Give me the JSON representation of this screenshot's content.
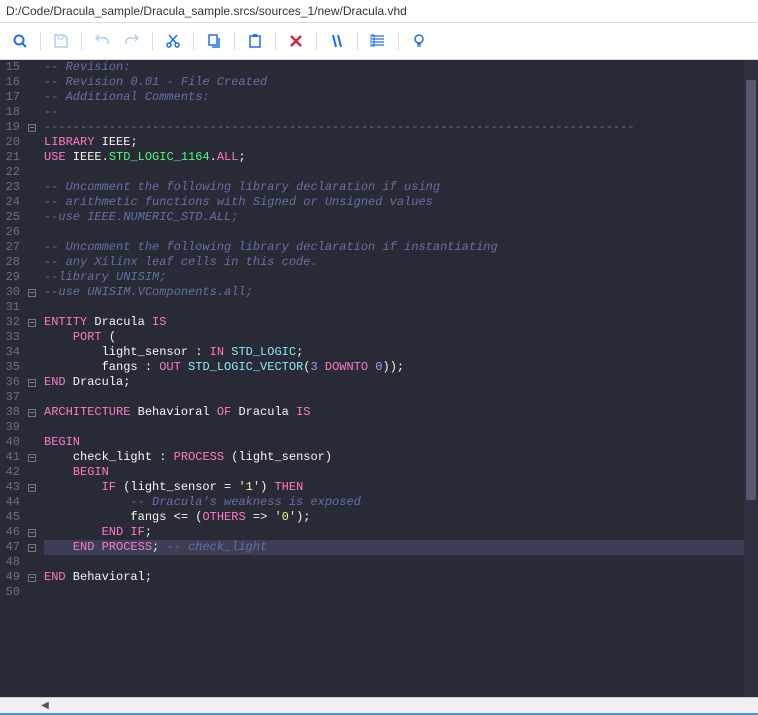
{
  "path": "D:/Code/Dracula_sample/Dracula_sample.srcs/sources_1/new/Dracula.vhd",
  "code_lines": [
    {
      "num": 15,
      "fold": "",
      "tokens": [
        {
          "c": "c-comment",
          "t": "-- Revision:"
        }
      ]
    },
    {
      "num": 16,
      "fold": "",
      "tokens": [
        {
          "c": "c-comment",
          "t": "-- Revision 0.01 - File Created"
        }
      ]
    },
    {
      "num": 17,
      "fold": "",
      "tokens": [
        {
          "c": "c-comment",
          "t": "-- Additional Comments:"
        }
      ]
    },
    {
      "num": 18,
      "fold": "",
      "tokens": [
        {
          "c": "c-comment",
          "t": "--"
        }
      ]
    },
    {
      "num": 19,
      "fold": "-",
      "tokens": [
        {
          "c": "c-comment",
          "t": "----------------------------------------------------------------------------------"
        }
      ]
    },
    {
      "num": 20,
      "fold": "",
      "tokens": [
        {
          "c": "c-key",
          "t": "LIBRARY"
        },
        {
          "c": "c-id",
          "t": " IEEE"
        },
        {
          "c": "c-punc",
          "t": ";"
        }
      ]
    },
    {
      "num": 21,
      "fold": "",
      "tokens": [
        {
          "c": "c-key",
          "t": "USE"
        },
        {
          "c": "c-id",
          "t": " IEEE"
        },
        {
          "c": "c-punc",
          "t": "."
        },
        {
          "c": "c-ent",
          "t": "STD_LOGIC_1164"
        },
        {
          "c": "c-punc",
          "t": "."
        },
        {
          "c": "c-key",
          "t": "ALL"
        },
        {
          "c": "c-punc",
          "t": ";"
        }
      ]
    },
    {
      "num": 22,
      "fold": "",
      "tokens": []
    },
    {
      "num": 23,
      "fold": "",
      "tokens": [
        {
          "c": "c-comment",
          "t": "-- Uncomment the following library declaration if using"
        }
      ]
    },
    {
      "num": 24,
      "fold": "",
      "tokens": [
        {
          "c": "c-comment",
          "t": "-- arithmetic functions with Signed or Unsigned values"
        }
      ]
    },
    {
      "num": 25,
      "fold": "",
      "tokens": [
        {
          "c": "c-comment",
          "t": "--use IEEE.NUMERIC_STD.ALL;"
        }
      ]
    },
    {
      "num": 26,
      "fold": "",
      "tokens": []
    },
    {
      "num": 27,
      "fold": "",
      "tokens": [
        {
          "c": "c-comment",
          "t": "-- Uncomment the following library declaration if instantiating"
        }
      ]
    },
    {
      "num": 28,
      "fold": "",
      "tokens": [
        {
          "c": "c-comment",
          "t": "-- any Xilinx leaf cells in this code."
        }
      ]
    },
    {
      "num": 29,
      "fold": "",
      "tokens": [
        {
          "c": "c-comment",
          "t": "--library UNISIM;"
        }
      ]
    },
    {
      "num": 30,
      "fold": "-",
      "tokens": [
        {
          "c": "c-comment",
          "t": "--use UNISIM.VComponents.all;"
        }
      ]
    },
    {
      "num": 31,
      "fold": "",
      "tokens": []
    },
    {
      "num": 32,
      "fold": "-",
      "tokens": [
        {
          "c": "c-key",
          "t": "ENTITY"
        },
        {
          "c": "c-id",
          "t": " Dracula "
        },
        {
          "c": "c-key",
          "t": "IS"
        }
      ]
    },
    {
      "num": 33,
      "fold": "",
      "tokens": [
        {
          "c": "",
          "t": "    "
        },
        {
          "c": "c-key",
          "t": "PORT"
        },
        {
          "c": "c-punc",
          "t": " ("
        }
      ]
    },
    {
      "num": 34,
      "fold": "",
      "tokens": [
        {
          "c": "",
          "t": "        "
        },
        {
          "c": "c-id",
          "t": "light_sensor "
        },
        {
          "c": "c-punc",
          "t": ": "
        },
        {
          "c": "c-key",
          "t": "IN"
        },
        {
          "c": "c-id",
          "t": " "
        },
        {
          "c": "c-type",
          "t": "STD_LOGIC"
        },
        {
          "c": "c-punc",
          "t": ";"
        }
      ]
    },
    {
      "num": 35,
      "fold": "",
      "tokens": [
        {
          "c": "",
          "t": "        "
        },
        {
          "c": "c-id",
          "t": "fangs "
        },
        {
          "c": "c-punc",
          "t": ": "
        },
        {
          "c": "c-key",
          "t": "OUT"
        },
        {
          "c": "c-id",
          "t": " "
        },
        {
          "c": "c-type",
          "t": "STD_LOGIC_VECTOR"
        },
        {
          "c": "c-punc",
          "t": "("
        },
        {
          "c": "c-num",
          "t": "3"
        },
        {
          "c": "c-id",
          "t": " "
        },
        {
          "c": "c-key",
          "t": "DOWNTO"
        },
        {
          "c": "c-id",
          "t": " "
        },
        {
          "c": "c-num",
          "t": "0"
        },
        {
          "c": "c-punc",
          "t": "));"
        }
      ]
    },
    {
      "num": 36,
      "fold": "-",
      "tokens": [
        {
          "c": "c-key",
          "t": "END"
        },
        {
          "c": "c-id",
          "t": " Dracula"
        },
        {
          "c": "c-punc",
          "t": ";"
        }
      ]
    },
    {
      "num": 37,
      "fold": "",
      "tokens": []
    },
    {
      "num": 38,
      "fold": "-",
      "tokens": [
        {
          "c": "c-key",
          "t": "ARCHITECTURE"
        },
        {
          "c": "c-id",
          "t": " Behavioral "
        },
        {
          "c": "c-key",
          "t": "OF"
        },
        {
          "c": "c-id",
          "t": " Dracula "
        },
        {
          "c": "c-key",
          "t": "IS"
        }
      ]
    },
    {
      "num": 39,
      "fold": "",
      "tokens": []
    },
    {
      "num": 40,
      "fold": "",
      "tokens": [
        {
          "c": "c-key",
          "t": "BEGIN"
        }
      ]
    },
    {
      "num": 41,
      "fold": "-",
      "tokens": [
        {
          "c": "",
          "t": "    "
        },
        {
          "c": "c-id",
          "t": "check_light "
        },
        {
          "c": "c-punc",
          "t": ": "
        },
        {
          "c": "c-key",
          "t": "PROCESS"
        },
        {
          "c": "c-punc",
          "t": " ("
        },
        {
          "c": "c-id",
          "t": "light_sensor"
        },
        {
          "c": "c-punc",
          "t": ")"
        }
      ]
    },
    {
      "num": 42,
      "fold": "",
      "tokens": [
        {
          "c": "",
          "t": "    "
        },
        {
          "c": "c-key",
          "t": "BEGIN"
        }
      ]
    },
    {
      "num": 43,
      "fold": "-",
      "tokens": [
        {
          "c": "",
          "t": "        "
        },
        {
          "c": "c-key",
          "t": "IF"
        },
        {
          "c": "c-punc",
          "t": " ("
        },
        {
          "c": "c-id",
          "t": "light_sensor "
        },
        {
          "c": "c-punc",
          "t": "= "
        },
        {
          "c": "c-str",
          "t": "'1'"
        },
        {
          "c": "c-punc",
          "t": ") "
        },
        {
          "c": "c-key",
          "t": "THEN"
        }
      ]
    },
    {
      "num": 44,
      "fold": "",
      "tokens": [
        {
          "c": "",
          "t": "            "
        },
        {
          "c": "c-comment",
          "t": "-- Dracula's weakness is exposed"
        }
      ]
    },
    {
      "num": 45,
      "fold": "",
      "tokens": [
        {
          "c": "",
          "t": "            "
        },
        {
          "c": "c-id",
          "t": "fangs "
        },
        {
          "c": "c-punc",
          "t": "<= ("
        },
        {
          "c": "c-key",
          "t": "OTHERS"
        },
        {
          "c": "c-punc",
          "t": " => "
        },
        {
          "c": "c-str",
          "t": "'0'"
        },
        {
          "c": "c-punc",
          "t": ");"
        }
      ]
    },
    {
      "num": 46,
      "fold": "-",
      "tokens": [
        {
          "c": "",
          "t": "        "
        },
        {
          "c": "c-key",
          "t": "END"
        },
        {
          "c": "c-id",
          "t": " "
        },
        {
          "c": "c-key",
          "t": "IF"
        },
        {
          "c": "c-punc",
          "t": ";"
        }
      ]
    },
    {
      "num": 47,
      "fold": "-",
      "current": true,
      "tokens": [
        {
          "c": "",
          "t": "    "
        },
        {
          "c": "c-key",
          "t": "END"
        },
        {
          "c": "c-id",
          "t": " "
        },
        {
          "c": "c-key",
          "t": "PROCESS"
        },
        {
          "c": "c-punc",
          "t": ";"
        },
        {
          "c": "c-comment",
          "t": " -- check_light"
        }
      ]
    },
    {
      "num": 48,
      "fold": "",
      "tokens": []
    },
    {
      "num": 49,
      "fold": "-",
      "tokens": [
        {
          "c": "c-key",
          "t": "END"
        },
        {
          "c": "c-id",
          "t": " Behavioral"
        },
        {
          "c": "c-punc",
          "t": ";"
        }
      ]
    },
    {
      "num": 50,
      "fold": "",
      "tokens": []
    }
  ]
}
